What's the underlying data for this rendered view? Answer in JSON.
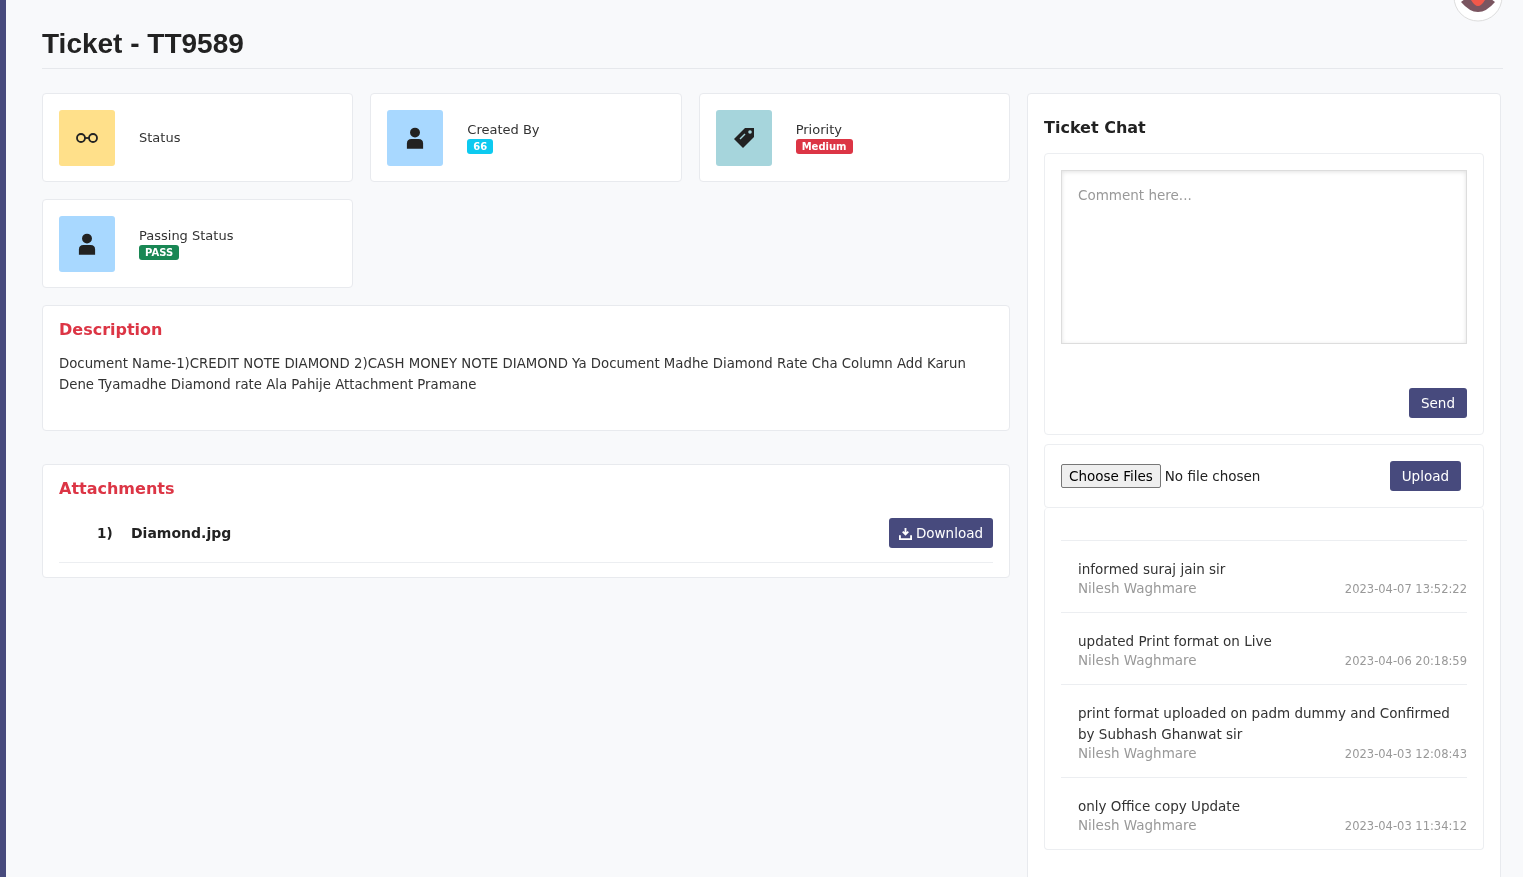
{
  "page": {
    "title": "Ticket - TT9589"
  },
  "info_cards": [
    {
      "kind": "glasses",
      "color": "#ffe08a",
      "label": "Status"
    },
    {
      "kind": "person",
      "color": "#a8d8ff",
      "label": "Created By",
      "badge": {
        "text": "66",
        "color": "#0dcaf0"
      }
    },
    {
      "kind": "tag",
      "color": "#a6d5dc",
      "label": "Priority",
      "badge": {
        "text": "Medium",
        "color": "#dc3545"
      }
    },
    {
      "kind": "person",
      "color": "#a8d8ff",
      "label": "Passing Status",
      "badge": {
        "text": "PASS",
        "color": "#198754"
      }
    }
  ],
  "description": {
    "title": "Description",
    "text": "Document Name-1)CREDIT NOTE DIAMOND 2)CASH MONEY NOTE DIAMOND Ya Document Madhe Diamond Rate Cha Column Add Karun Dene Tyamadhe Diamond rate Ala Pahije Attachment Pramane"
  },
  "attachments": {
    "title": "Attachments",
    "items": [
      {
        "number": "1)",
        "name": "Diamond.jpg",
        "button": "Download"
      }
    ]
  },
  "chat": {
    "title": "Ticket Chat",
    "placeholder": "Comment here...",
    "send": "Send",
    "choose_files": "Choose Files",
    "no_file": "No file chosen",
    "upload": "Upload",
    "comments": [
      {
        "text": "informed suraj jain sir",
        "author": "Nilesh Waghmare",
        "time": "2023-04-07 13:52:22"
      },
      {
        "text": "updated Print format on Live",
        "author": "Nilesh Waghmare",
        "time": "2023-04-06 20:18:59"
      },
      {
        "text": "print format uploaded on padm dummy and Confirmed by Subhash Ghanwat sir",
        "author": "Nilesh Waghmare",
        "time": "2023-04-03 12:08:43"
      },
      {
        "text": "only Office copy Update",
        "author": "Nilesh Waghmare",
        "time": "2023-04-03 11:34:12"
      }
    ]
  }
}
